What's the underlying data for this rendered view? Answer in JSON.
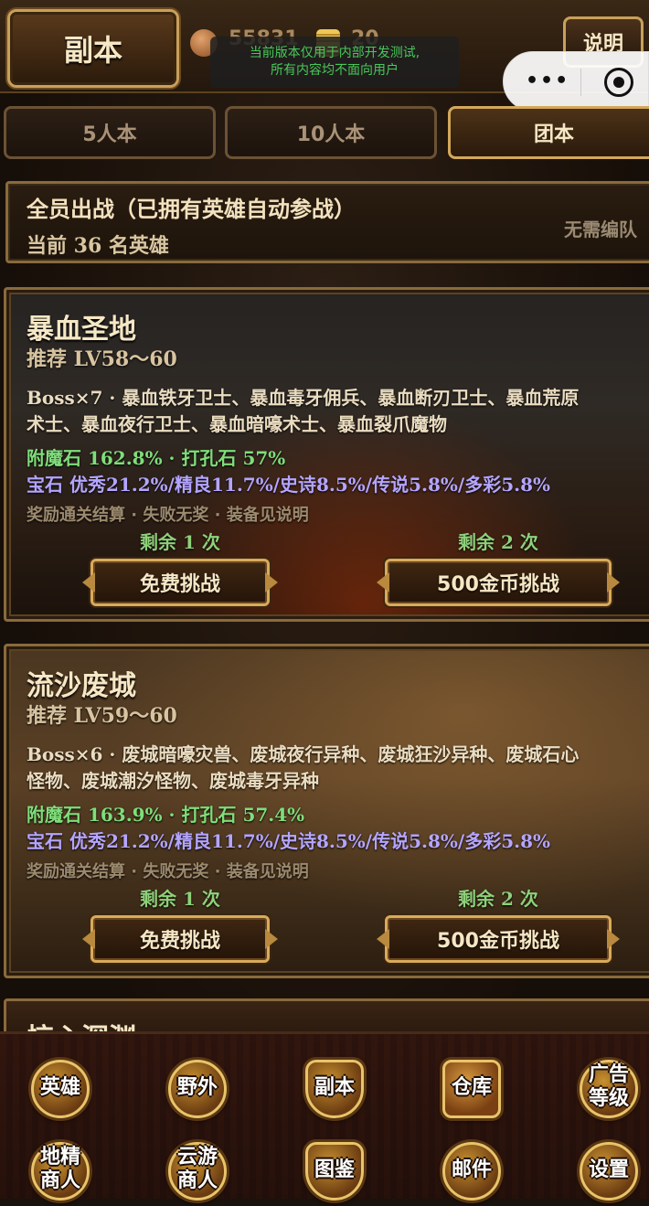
{
  "header": {
    "title": "副本",
    "copper": "55831",
    "gold": "20",
    "dev_notice_line1": "当前版本仅用于内部开发测试,",
    "dev_notice_line2": "所有内容均不面向用户",
    "help_label": "说明",
    "capsule_more": "•••"
  },
  "tabs": [
    {
      "label": "5人本",
      "active": false
    },
    {
      "label": "10人本",
      "active": false
    },
    {
      "label": "团本",
      "active": true
    }
  ],
  "roster": {
    "title": "全员出战（已拥有英雄自动参战）",
    "count": "当前 36 名英雄",
    "note": "无需编队"
  },
  "dungeons": [
    {
      "name": "暴血圣地",
      "recommend": "推荐 LV58～60",
      "boss_line1": "Boss×7 · 暴血铁牙卫士、暴血毒牙佣兵、暴血断刃卫士、暴血荒原",
      "boss_line2": "术士、暴血夜行卫士、暴血暗嚎术士、暴血裂爪魔物",
      "drops": "附魔石 162.8% · 打孔石 57%",
      "gems": "宝石 优秀21.2%/精良11.7%/史诗8.5%/传说5.8%/多彩5.8%",
      "rule": "奖励通关结算 · 失败无奖 · 装备见说明",
      "free_remaining": "剩余 1 次",
      "paid_remaining": "剩余 2 次",
      "free_button": "免费挑战",
      "paid_button": "500金币挑战"
    },
    {
      "name": "流沙废城",
      "recommend": "推荐 LV59～60",
      "boss_line1": "Boss×6 · 废城暗嚎灾兽、废城夜行异种、废城狂沙异种、废城石心",
      "boss_line2": "怪物、废城潮汐怪物、废城毒牙异种",
      "drops": "附魔石 163.9% · 打孔石 57.4%",
      "gems": "宝石 优秀21.2%/精良11.7%/史诗8.5%/传说5.8%/多彩5.8%",
      "rule": "奖励通关结算 · 失败无奖 · 装备见说明",
      "free_remaining": "剩余 1 次",
      "paid_remaining": "剩余 2 次",
      "free_button": "免费挑战",
      "paid_button": "500金币挑战"
    },
    {
      "name": "惊心深渊"
    }
  ],
  "nav": {
    "row1": [
      {
        "label": "英雄",
        "icon": "axes-emblem-icon"
      },
      {
        "label": "野外",
        "icon": "compass-emblem-icon"
      },
      {
        "label": "副本",
        "icon": "skull-castle-icon"
      },
      {
        "label": "仓库",
        "icon": "treasure-chest-icon"
      },
      {
        "label1": "广告",
        "label2": "等级",
        "icon": "ad-badge-icon"
      }
    ],
    "row2": [
      {
        "label1": "地精",
        "label2": "商人",
        "icon": "goblin-merchant-icon"
      },
      {
        "label1": "云游",
        "label2": "商人",
        "icon": "wandering-merchant-icon"
      },
      {
        "label": "图鉴",
        "icon": "codex-icon"
      },
      {
        "label": "邮件",
        "icon": "mail-icon"
      },
      {
        "label": "设置",
        "icon": "gear-icon"
      }
    ]
  }
}
